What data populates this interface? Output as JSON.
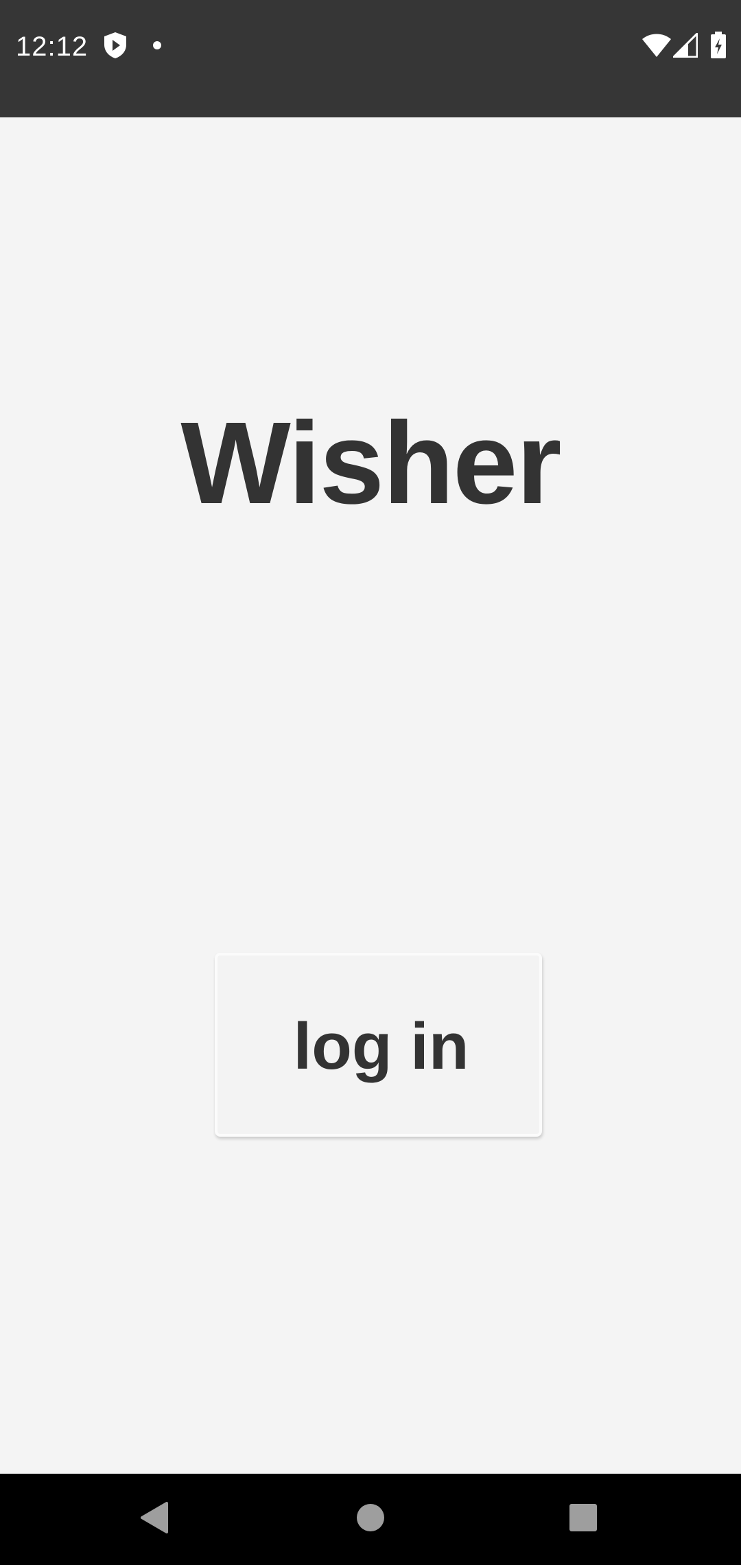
{
  "status_bar": {
    "time": "12:12",
    "icons": [
      "shield-play-icon",
      "notification-dot-icon",
      "wifi-icon",
      "cell-signal-icon",
      "battery-charging-icon"
    ]
  },
  "app": {
    "title": "Wisher"
  },
  "login": {
    "label": "log in"
  },
  "nav_bar": {
    "icons": [
      "back-icon",
      "home-icon",
      "recents-icon"
    ]
  },
  "colors": {
    "status_bar_bg": "#363636",
    "background": "#f4f4f4",
    "text": "#333333",
    "nav_bar_bg": "#000000",
    "nav_icon": "#9e9e9e"
  }
}
